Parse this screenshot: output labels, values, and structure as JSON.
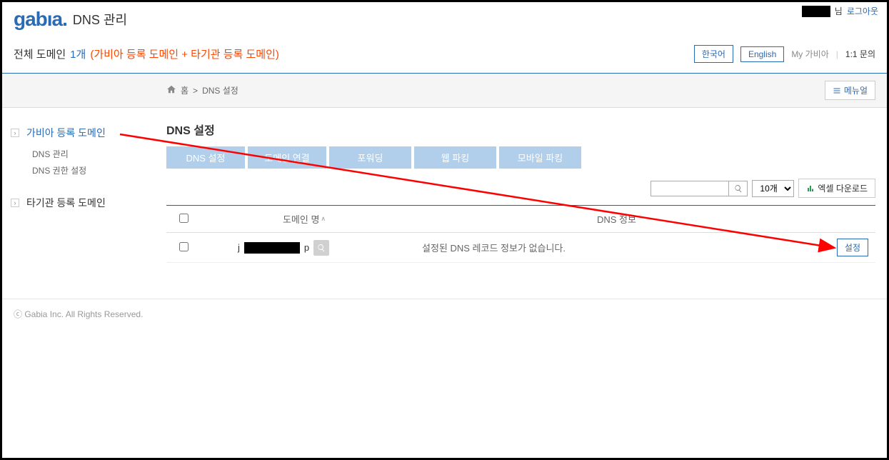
{
  "header": {
    "logo_text": "gabıa.",
    "page_title": "DNS 관리",
    "user_suffix": "님",
    "logout": "로그아웃"
  },
  "info": {
    "total_label": "전체 도메인",
    "count": "1개",
    "paren": "(가비아 등록 도메인 + 타기관 등록 도메인)",
    "lang_ko": "한국어",
    "lang_en": "English",
    "my_gabia": "My 가비아",
    "inquiry": "1:1 문의"
  },
  "breadcrumb": {
    "home": "홈",
    "sep": ">",
    "current": "DNS 설정",
    "manual_btn": "메뉴얼"
  },
  "sidebar": {
    "gabia_domain": "가비아 등록 도메인",
    "subs": {
      "dns_manage": "DNS 관리",
      "dns_auth": "DNS 권한 설정"
    },
    "other_domain": "타기관 등록 도메인"
  },
  "content": {
    "title": "DNS 설정",
    "tabs": {
      "t1": "DNS 설정",
      "t2": "도메인 연결",
      "t3": "포워딩",
      "t4": "웹 파킹",
      "t5": "모바일 파킹"
    },
    "page_select": "10개",
    "excel_btn": "엑셀 다운로드",
    "th_domain": "도메인 명",
    "th_dns": "DNS 정보",
    "row": {
      "prefix": "j",
      "suffix": "p",
      "dns_info": "설정된 DNS 레코드 정보가 없습니다.",
      "cfg": "설정"
    }
  },
  "footer": {
    "copyright": "ⓒ Gabia Inc. All Rights Reserved."
  }
}
